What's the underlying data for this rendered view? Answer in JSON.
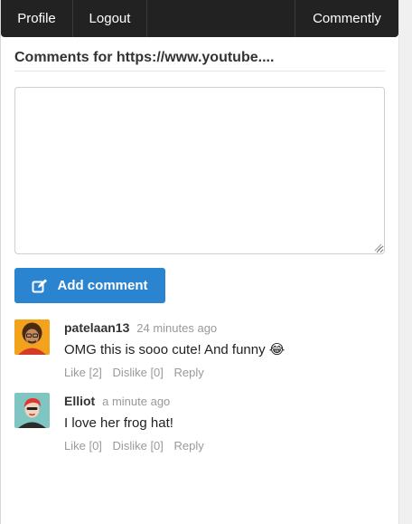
{
  "nav": {
    "profile_label": "Profile",
    "logout_label": "Logout",
    "brand_label": "Commently"
  },
  "heading": {
    "title": "Comments for https://www.youtube...."
  },
  "composer": {
    "value": "",
    "add_label": "Add comment"
  },
  "comments": [
    {
      "author": "patelaan13",
      "time": "24 minutes ago",
      "text": "OMG this is sooo cute! And funny",
      "emoji": "😂",
      "like_label": "Like [2]",
      "dislike_label": "Dislike [0]",
      "reply_label": "Reply"
    },
    {
      "author": "Elliot",
      "time": "a minute ago",
      "text": "I love her frog hat!",
      "emoji": "",
      "like_label": "Like [0]",
      "dislike_label": "Dislike [0]",
      "reply_label": "Reply"
    }
  ],
  "colors": {
    "navbar_bg": "#222222",
    "button_bg": "#2b84d0",
    "muted_text": "#999999"
  },
  "icons": {
    "add_button_icon": "edit-icon",
    "avatar_1": "avatar-icon",
    "avatar_2": "avatar-icon"
  }
}
